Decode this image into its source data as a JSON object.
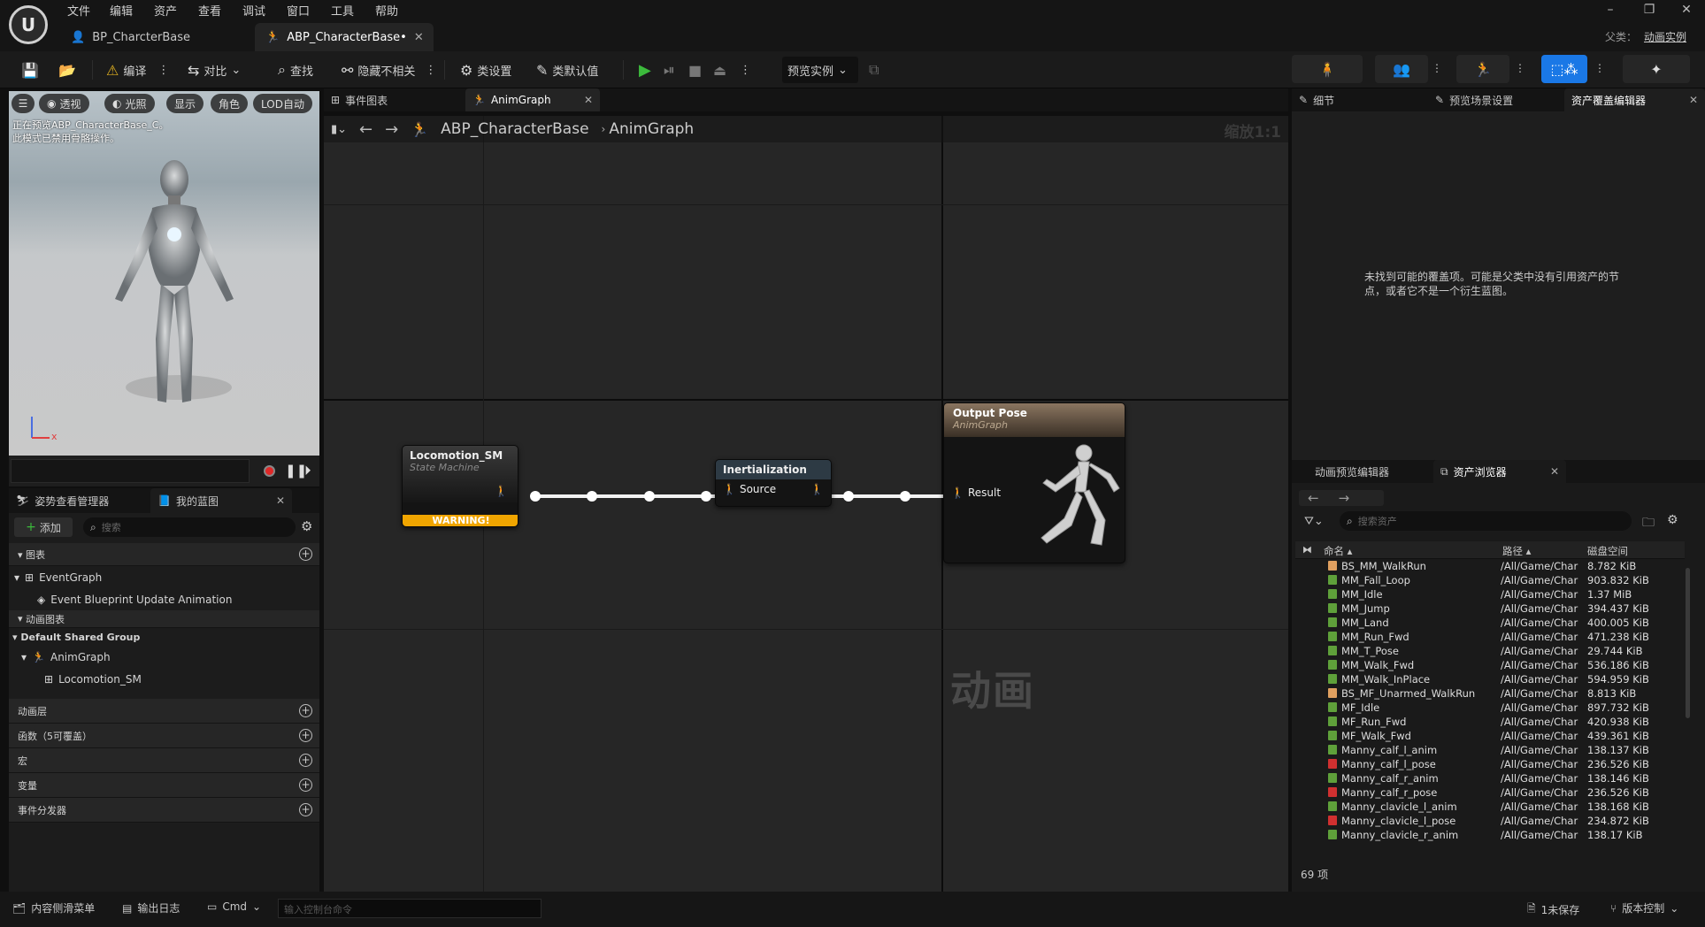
{
  "menu": [
    "文件",
    "编辑",
    "资产",
    "查看",
    "调试",
    "窗口",
    "工具",
    "帮助"
  ],
  "tabs": [
    {
      "label": "BP_CharcterBase"
    },
    {
      "label": "ABP_CharacterBase•"
    }
  ],
  "parent": {
    "label": "父类：",
    "value": "动画实例"
  },
  "toolbar": {
    "compile": "编译",
    "diff": "对比",
    "find": "查找",
    "hide_unrelated": "隐藏不相关",
    "class_settings": "类设置",
    "class_defaults": "类默认值",
    "preview_instance": "预览实例"
  },
  "viewport": {
    "buttons": [
      "透视",
      "光照",
      "显示",
      "角色",
      "LOD自动"
    ],
    "message": "正在预览ABP_CharacterBase_C。\n此模式已禁用骨骼操作。",
    "axis_x": "x"
  },
  "left_tabs": {
    "pose_watch": "姿势查看管理器",
    "my_blueprint": "我的蓝图"
  },
  "my_blueprint": {
    "add": "添加",
    "search_placeholder": "搜索",
    "graphs_header": "图表",
    "event_graph": "EventGraph",
    "event_update": "Event Blueprint Update Animation",
    "anim_graphs_header": "动画图表",
    "shared_group": "Default Shared Group",
    "anim_graph": "AnimGraph",
    "locomotion": "Locomotion_SM",
    "anim_layers": "动画层",
    "functions": "函数（5可覆盖）",
    "macros": "宏",
    "variables": "变量",
    "event_dispatchers": "事件分发器"
  },
  "graph_tabs": {
    "event_graph": "事件图表",
    "anim_graph": "AnimGraph"
  },
  "breadcrumb": {
    "root": "ABP_CharacterBase",
    "current": "AnimGraph",
    "zoom": "缩放1:1"
  },
  "nodes": {
    "locomotion": {
      "title": "Locomotion_SM",
      "subtitle": "State Machine",
      "warning": "WARNING!"
    },
    "inertialization": {
      "title": "Inertialization",
      "pin": "Source"
    },
    "output": {
      "title": "Output Pose",
      "subtitle": "AnimGraph",
      "pin": "Result"
    }
  },
  "watermark": "动画",
  "details_tabs": {
    "details": "细节",
    "preview_scene": "预览场景设置",
    "asset_override": "资产覆盖编辑器"
  },
  "details_message": "未找到可能的覆盖项。可能是父类中没有引用资产的节点，或者它不是一个衍生蓝图。",
  "bottom_tabs": {
    "anim_preview": "动画预览编辑器",
    "asset_browser": "资产浏览器"
  },
  "asset_browser": {
    "search_placeholder": "搜索资产",
    "columns": {
      "name": "命名",
      "path": "路径",
      "size": "磁盘空间"
    },
    "count": "69 项",
    "rows": [
      {
        "name": "BS_MM_WalkRun",
        "path": "/All/Game/Char",
        "size": "8.782 KiB",
        "color": "#e0a060"
      },
      {
        "name": "MM_Fall_Loop",
        "path": "/All/Game/Char",
        "size": "903.832 KiB",
        "color": "#5fa03a"
      },
      {
        "name": "MM_Idle",
        "path": "/All/Game/Char",
        "size": "1.37 MiB",
        "color": "#5fa03a"
      },
      {
        "name": "MM_Jump",
        "path": "/All/Game/Char",
        "size": "394.437 KiB",
        "color": "#5fa03a"
      },
      {
        "name": "MM_Land",
        "path": "/All/Game/Char",
        "size": "400.005 KiB",
        "color": "#5fa03a"
      },
      {
        "name": "MM_Run_Fwd",
        "path": "/All/Game/Char",
        "size": "471.238 KiB",
        "color": "#5fa03a"
      },
      {
        "name": "MM_T_Pose",
        "path": "/All/Game/Char",
        "size": "29.744 KiB",
        "color": "#5fa03a"
      },
      {
        "name": "MM_Walk_Fwd",
        "path": "/All/Game/Char",
        "size": "536.186 KiB",
        "color": "#5fa03a"
      },
      {
        "name": "MM_Walk_InPlace",
        "path": "/All/Game/Char",
        "size": "594.959 KiB",
        "color": "#5fa03a"
      },
      {
        "name": "BS_MF_Unarmed_WalkRun",
        "path": "/All/Game/Char",
        "size": "8.813 KiB",
        "color": "#e0a060"
      },
      {
        "name": "MF_Idle",
        "path": "/All/Game/Char",
        "size": "897.732 KiB",
        "color": "#5fa03a"
      },
      {
        "name": "MF_Run_Fwd",
        "path": "/All/Game/Char",
        "size": "420.938 KiB",
        "color": "#5fa03a"
      },
      {
        "name": "MF_Walk_Fwd",
        "path": "/All/Game/Char",
        "size": "439.361 KiB",
        "color": "#5fa03a"
      },
      {
        "name": "Manny_calf_l_anim",
        "path": "/All/Game/Char",
        "size": "138.137 KiB",
        "color": "#5fa03a"
      },
      {
        "name": "Manny_calf_l_pose",
        "path": "/All/Game/Char",
        "size": "236.526 KiB",
        "color": "#d03030"
      },
      {
        "name": "Manny_calf_r_anim",
        "path": "/All/Game/Char",
        "size": "138.146 KiB",
        "color": "#5fa03a"
      },
      {
        "name": "Manny_calf_r_pose",
        "path": "/All/Game/Char",
        "size": "236.526 KiB",
        "color": "#d03030"
      },
      {
        "name": "Manny_clavicle_l_anim",
        "path": "/All/Game/Char",
        "size": "138.168 KiB",
        "color": "#5fa03a"
      },
      {
        "name": "Manny_clavicle_l_pose",
        "path": "/All/Game/Char",
        "size": "234.872 KiB",
        "color": "#d03030"
      },
      {
        "name": "Manny_clavicle_r_anim",
        "path": "/All/Game/Char",
        "size": "138.17 KiB",
        "color": "#5fa03a"
      }
    ]
  },
  "statusbar": {
    "content_drawer": "内容侧滑菜单",
    "output_log": "输出日志",
    "cmd": "Cmd",
    "console_placeholder": "输入控制台命令",
    "unsaved": "1未保存",
    "source_control": "版本控制"
  }
}
